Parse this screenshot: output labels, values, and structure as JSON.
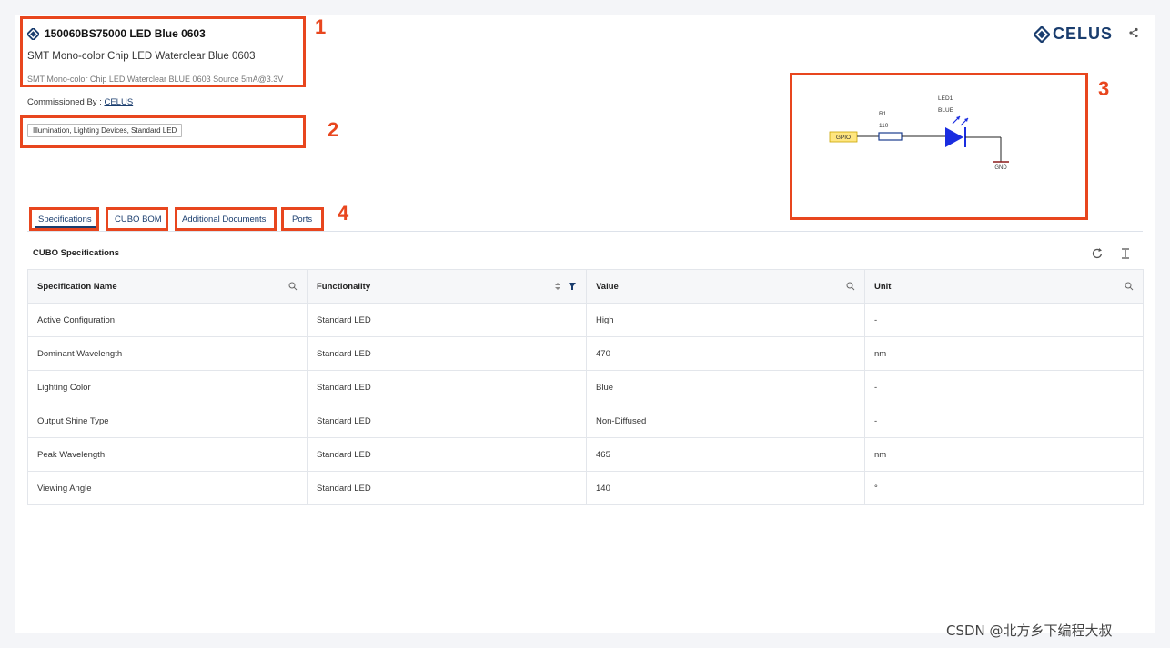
{
  "header": {
    "part_number": "150060BS75000 LED Blue 0603",
    "description": "SMT Mono-color Chip LED Waterclear Blue 0603",
    "sub_description": "SMT Mono-color Chip LED Waterclear BLUE 0603 Source 5mA@3.3V",
    "commissioned_label": "Commissioned By : ",
    "commissioned_by": "CELUS",
    "tag": "Illumination, Lighting Devices, Standard LED",
    "logo_text": "CELUS",
    "accent_color": "#1a3d6e"
  },
  "schematic": {
    "gpio_label": "GPIO",
    "resistor_ref": "R1",
    "resistor_value": "110",
    "led_ref": "LED1",
    "led_color_label": "BLUE",
    "ground_label": "GND"
  },
  "annotations": [
    "1",
    "2",
    "3",
    "4"
  ],
  "tabs": [
    {
      "label": "Specifications"
    },
    {
      "label": "CUBO BOM"
    },
    {
      "label": "Additional Documents"
    },
    {
      "label": "Ports"
    }
  ],
  "section_title": "CUBO Specifications",
  "table": {
    "headers": [
      "Specification Name",
      "Functionality",
      "Value",
      "Unit"
    ],
    "rows": [
      [
        "Active Configuration",
        "Standard LED",
        "High",
        "-"
      ],
      [
        "Dominant Wavelength",
        "Standard LED",
        "470",
        "nm"
      ],
      [
        "Lighting Color",
        "Standard LED",
        "Blue",
        "-"
      ],
      [
        "Output Shine Type",
        "Standard LED",
        "Non-Diffused",
        "-"
      ],
      [
        "Peak Wavelength",
        "Standard LED",
        "465",
        "nm"
      ],
      [
        "Viewing Angle",
        "Standard LED",
        "140",
        "°"
      ]
    ]
  },
  "watermark": "CSDN @北方乡下编程大叔"
}
